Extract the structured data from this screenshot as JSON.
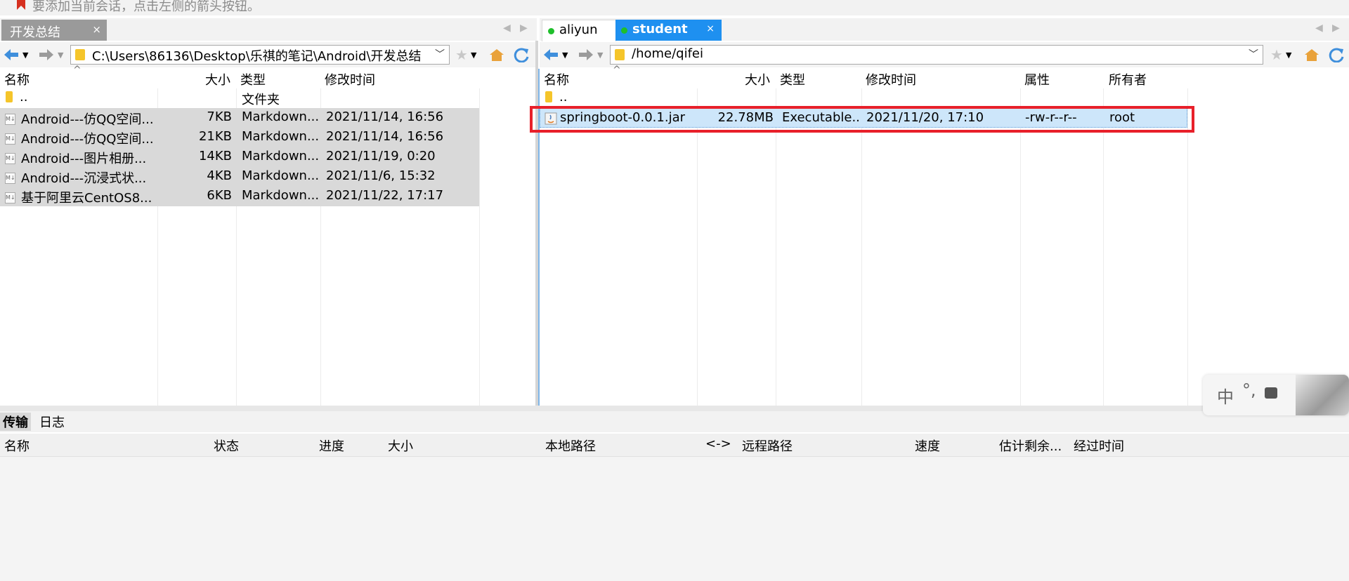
{
  "hint": {
    "text": "要添加当前会话，点击左侧的箭头按钮。"
  },
  "left_tab": {
    "label": "开发总结",
    "close": "×"
  },
  "right_tabs": [
    {
      "label": "aliyun"
    },
    {
      "label": "student",
      "close": "×"
    }
  ],
  "left_path": "C:\\Users\\86136\\Desktop\\乐祺的笔记\\Android\\开发总结",
  "right_path": "/home/qifei",
  "left_headers": {
    "name": "名称",
    "size": "大小",
    "type": "类型",
    "modified": "修改时间"
  },
  "left_rows": [
    {
      "name": "..",
      "size": "",
      "type": "文件夹",
      "modified": ""
    },
    {
      "name": "Android---仿QQ空间...",
      "size": "7KB",
      "type": "Markdown...",
      "modified": "2021/11/14, 16:56"
    },
    {
      "name": "Android---仿QQ空间...",
      "size": "21KB",
      "type": "Markdown...",
      "modified": "2021/11/14, 16:56"
    },
    {
      "name": "Android---图片相册...",
      "size": "14KB",
      "type": "Markdown...",
      "modified": "2021/11/19, 0:20"
    },
    {
      "name": "Android---沉浸式状...",
      "size": "4KB",
      "type": "Markdown...",
      "modified": "2021/11/6, 15:32"
    },
    {
      "name": "基于阿里云CentOS8...",
      "size": "6KB",
      "type": "Markdown...",
      "modified": "2021/11/22, 17:17"
    }
  ],
  "right_headers": {
    "name": "名称",
    "size": "大小",
    "type": "类型",
    "modified": "修改时间",
    "attr": "属性",
    "owner": "所有者"
  },
  "right_rows": [
    {
      "name": "..",
      "size": "",
      "type": "",
      "modified": "",
      "attr": "",
      "owner": ""
    },
    {
      "name": "springboot-0.0.1.jar",
      "size": "22.78MB",
      "type": "Executable...",
      "modified": "2021/11/20, 17:10",
      "attr": "-rw-r--r--",
      "owner": "root"
    }
  ],
  "bottom_tabs": [
    {
      "label": "传输"
    },
    {
      "label": "日志"
    }
  ],
  "transfer_headers": {
    "name": "名称",
    "status": "状态",
    "progress": "进度",
    "size": "大小",
    "local": "本地路径",
    "dir": "<->",
    "remote": "远程路径",
    "speed": "速度",
    "eta": "估计剩余...",
    "elapsed": "经过时间"
  },
  "ime": {
    "lang": "中",
    "punct": "°,"
  },
  "colors": {
    "accent": "#1e90f0",
    "highlight": "#e8202a",
    "online": "#1fbf2b"
  }
}
